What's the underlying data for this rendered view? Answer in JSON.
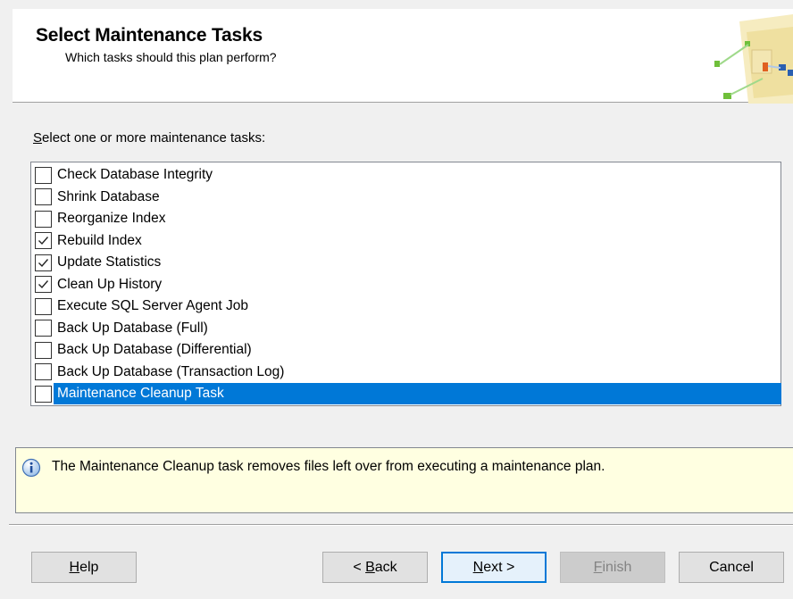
{
  "header": {
    "title": "Select Maintenance Tasks",
    "subtitle": "Which tasks should this plan perform?"
  },
  "task_list": {
    "label": "Select one or more maintenance tasks:",
    "items": [
      {
        "label": "Check Database Integrity",
        "checked": false,
        "selected": false
      },
      {
        "label": "Shrink Database",
        "checked": false,
        "selected": false
      },
      {
        "label": "Reorganize Index",
        "checked": false,
        "selected": false
      },
      {
        "label": "Rebuild Index",
        "checked": true,
        "selected": false
      },
      {
        "label": "Update Statistics",
        "checked": true,
        "selected": false
      },
      {
        "label": "Clean Up History",
        "checked": true,
        "selected": false
      },
      {
        "label": "Execute SQL Server Agent Job",
        "checked": false,
        "selected": false
      },
      {
        "label": "Back Up Database (Full)",
        "checked": false,
        "selected": false
      },
      {
        "label": "Back Up Database (Differential)",
        "checked": false,
        "selected": false
      },
      {
        "label": "Back Up Database (Transaction Log)",
        "checked": false,
        "selected": false
      },
      {
        "label": "Maintenance Cleanup Task",
        "checked": false,
        "selected": true
      }
    ]
  },
  "info": {
    "icon": "info-icon",
    "text": "The Maintenance Cleanup task removes files left over from executing a maintenance plan."
  },
  "buttons": {
    "help": "Help",
    "back": "< Back",
    "next": "Next >",
    "finish": "Finish",
    "cancel": "Cancel"
  },
  "colors": {
    "selection": "#0078d7",
    "info_background": "#ffffe1",
    "dialog_background": "#f0f0f0"
  }
}
